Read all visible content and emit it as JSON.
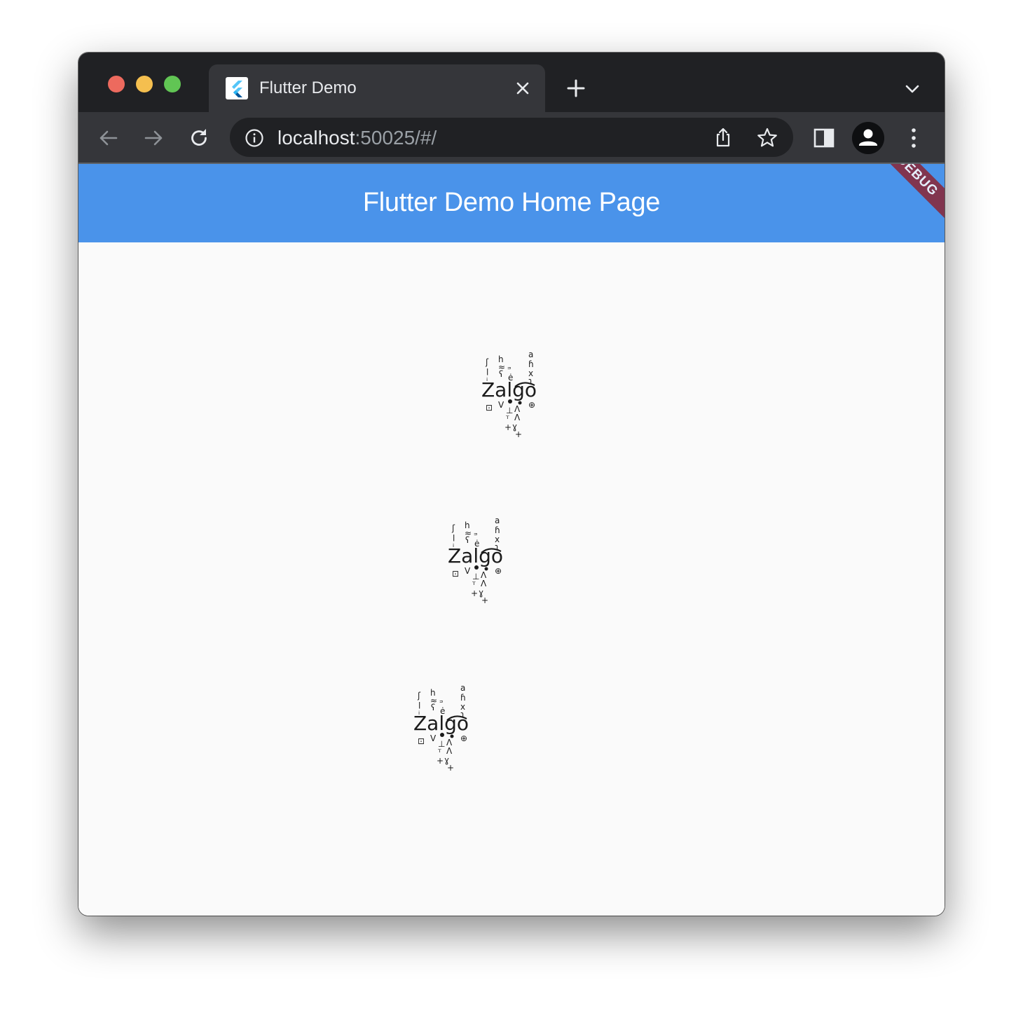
{
  "browser": {
    "tab": {
      "title": "Flutter Demo"
    },
    "address": {
      "host": "localhost",
      "rest": ":50025/#/"
    },
    "icons": {
      "close": "close-icon",
      "new_tab": "plus-icon",
      "tab_search": "chevron-down-icon",
      "back": "arrow-left-icon",
      "forward": "arrow-right-icon",
      "reload": "reload-icon",
      "site_info": "info-icon",
      "share": "share-icon",
      "bookmark": "star-icon",
      "side_panel": "side-panel-icon",
      "profile": "person-icon",
      "menu": "kebab-menu-icon"
    }
  },
  "app": {
    "title": "Flutter Demo Home Page",
    "debug_banner": "DEBUG",
    "colors": {
      "appbar": "#4a93ea",
      "banner": "#8b2535",
      "background": "#fafafa"
    },
    "zalgo_items": [
      {
        "text": "Zalgo"
      },
      {
        "text": "Zalgo"
      },
      {
        "text": "Zalgo"
      }
    ]
  }
}
